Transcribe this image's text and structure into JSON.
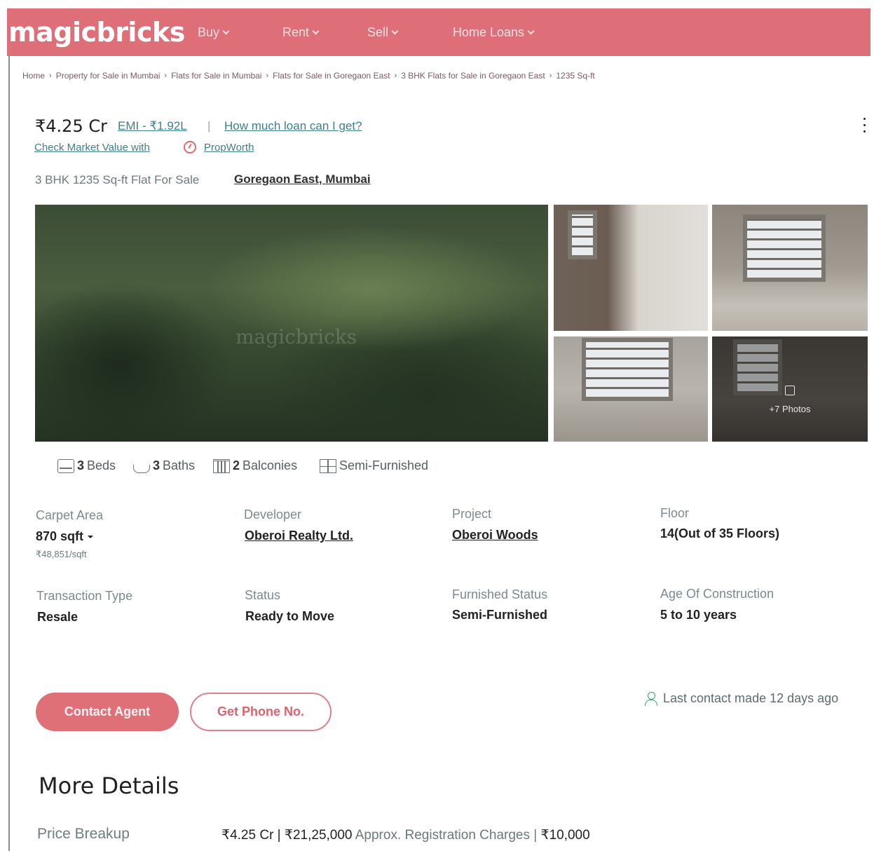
{
  "header": {
    "logo": "magicbricks",
    "nav": [
      {
        "label": "Buy"
      },
      {
        "label": "Rent"
      },
      {
        "label": "Sell"
      },
      {
        "label": "Home Loans"
      }
    ],
    "brand_color": "#de6f78"
  },
  "breadcrumb": [
    "Home",
    "Property for Sale in Mumbai",
    "Flats for Sale in Mumbai",
    "Flats for Sale in Goregaon East",
    "3 BHK Flats for Sale in Goregaon East",
    "1235 Sq-ft"
  ],
  "listing": {
    "price": "₹4.25 Cr",
    "emi": "EMI - ₹1.92L",
    "pipe": "|",
    "loan_link": "How much loan can I get?",
    "market_value_link": "Check Market Value with",
    "propworth": "PropWorth",
    "subtitle": "3 BHK 1235 Sq-ft Flat For Sale",
    "locality": "Goregaon East, Mumbai"
  },
  "gallery": {
    "watermark": "magicbricks",
    "more_photos": "+7 Photos"
  },
  "amenities": {
    "beds_count": "3",
    "beds_label": "Beds",
    "baths_count": "3",
    "baths_label": "Baths",
    "balconies_count": "2",
    "balconies_label": "Balconies",
    "furnishing": "Semi-Furnished"
  },
  "details": {
    "carpet_area_label": "Carpet Area",
    "carpet_area_value": "870 sqft",
    "carpet_area_rate": "₹48,851/sqft",
    "developer_label": "Developer",
    "developer_value": "Oberoi Realty Ltd.",
    "project_label": "Project",
    "project_value": "Oberoi Woods",
    "floor_label": "Floor",
    "floor_value": "14(Out of 35 Floors)",
    "transaction_label": "Transaction Type",
    "transaction_value": "Resale",
    "status_label": "Status",
    "status_value": "Ready to Move",
    "furnished_label": "Furnished Status",
    "furnished_value": "Semi-Furnished",
    "age_label": "Age Of Construction",
    "age_value": "5 to 10 years"
  },
  "actions": {
    "contact_agent": "Contact Agent",
    "get_phone": "Get Phone No.",
    "last_contact": "Last contact made 12 days ago"
  },
  "more_details": {
    "heading": "More Details",
    "price_breakup_label": "Price Breakup",
    "price_breakup_value": "₹4.25 Cr | ₹21,25,000",
    "registration_label": "Approx. Registration Charges |",
    "registration_value": "₹10,000"
  }
}
